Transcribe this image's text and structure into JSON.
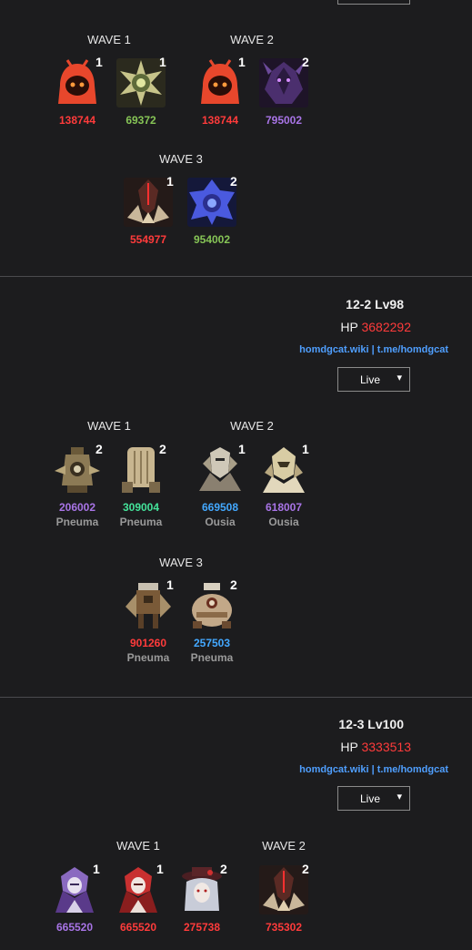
{
  "colors": {
    "red": "#ff3b3b",
    "green": "#86c456",
    "purple": "#a874e6",
    "blue": "#43a8ff",
    "mint": "#44e39a",
    "link": "#4f9fff",
    "type_gray": "#9a9a9a"
  },
  "top_section": {
    "waves": [
      {
        "label": "WAVE 1",
        "enemies": [
          {
            "icon": "red-hooded-ghost-icon",
            "count": "1",
            "hp": "138744",
            "hp_color": "red"
          },
          {
            "icon": "golden-spiked-orb-icon",
            "count": "1",
            "hp": "69372",
            "hp_color": "green"
          }
        ]
      },
      {
        "label": "WAVE 2",
        "enemies": [
          {
            "icon": "red-hooded-ghost-icon",
            "count": "1",
            "hp": "138744",
            "hp_color": "red"
          },
          {
            "icon": "purple-armored-beast-icon",
            "count": "2",
            "hp": "795002",
            "hp_color": "purple"
          }
        ]
      },
      {
        "label": "WAVE 3",
        "enemies": [
          {
            "icon": "crimson-horned-lord-icon",
            "count": "1",
            "hp": "554977",
            "hp_color": "red"
          },
          {
            "icon": "blue-crystal-flower-icon",
            "count": "2",
            "hp": "954002",
            "hp_color": "green"
          }
        ]
      }
    ]
  },
  "stage_12_2": {
    "title": "12-2 Lv98",
    "hp_label": "HP",
    "hp_value": "3682292",
    "link_wiki": "homdgcat.wiki",
    "link_sep": "|",
    "link_tg": "t.me/homdgcat",
    "select_value": "Live",
    "waves": [
      {
        "label": "WAVE 1",
        "enemies": [
          {
            "icon": "bronze-eye-turret-icon",
            "count": "2",
            "hp": "206002",
            "hp_color": "purple",
            "type": "Pneuma"
          },
          {
            "icon": "tan-armored-cylinder-icon",
            "count": "2",
            "hp": "309004",
            "hp_color": "mint",
            "type": "Pneuma"
          }
        ]
      },
      {
        "label": "WAVE 2",
        "enemies": [
          {
            "icon": "silver-mech-knight-icon",
            "count": "1",
            "hp": "669508",
            "hp_color": "blue",
            "type": "Ousia"
          },
          {
            "icon": "gold-helmet-knight-icon",
            "count": "1",
            "hp": "618007",
            "hp_color": "purple",
            "type": "Ousia"
          }
        ]
      },
      {
        "label": "WAVE 3",
        "enemies": [
          {
            "icon": "bronze-winged-mech-icon",
            "count": "1",
            "hp": "901260",
            "hp_color": "red",
            "type": "Pneuma"
          },
          {
            "icon": "round-bronze-golem-icon",
            "count": "2",
            "hp": "257503",
            "hp_color": "blue",
            "type": "Pneuma"
          }
        ]
      }
    ]
  },
  "stage_12_3": {
    "title": "12-3 Lv100",
    "hp_label": "HP",
    "hp_value": "3333513",
    "link_wiki": "homdgcat.wiki",
    "link_sep": "|",
    "link_tg": "t.me/homdgcat",
    "select_value": "Live",
    "waves": [
      {
        "label": "WAVE 1",
        "enemies": [
          {
            "icon": "purple-masked-priest-icon",
            "count": "1",
            "hp": "665520",
            "hp_color": "purple"
          },
          {
            "icon": "red-masked-priest-icon",
            "count": "1",
            "hp": "665520",
            "hp_color": "red"
          },
          {
            "icon": "hatted-silver-hair-icon",
            "count": "2",
            "hp": "275738",
            "hp_color": "red"
          }
        ]
      },
      {
        "label": "WAVE 2",
        "enemies": [
          {
            "icon": "crimson-horned-lord-icon",
            "count": "2",
            "hp": "735302",
            "hp_color": "red"
          }
        ]
      }
    ]
  }
}
